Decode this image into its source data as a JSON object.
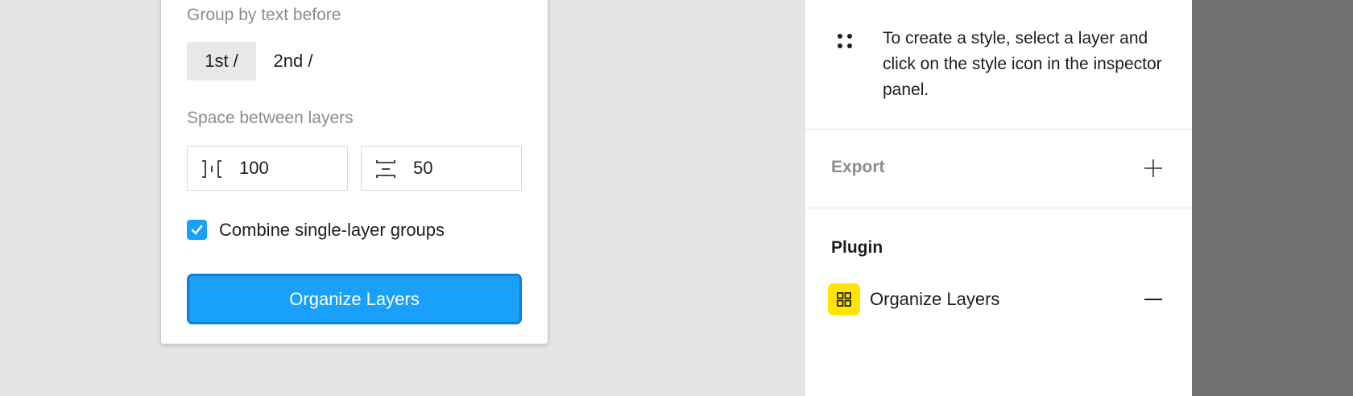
{
  "plugin_panel": {
    "group_label": "Group by text before",
    "segments": [
      "1st /",
      "2nd /"
    ],
    "space_label": "Space between layers",
    "horizontal_spacing": "100",
    "vertical_spacing": "50",
    "combine_label": "Combine single-layer groups",
    "combine_checked": true,
    "button_label": "Organize Layers"
  },
  "inspector": {
    "styles_hint": "To create a style, select a layer and click on the style icon in the inspector panel.",
    "export_title": "Export",
    "plugin_title": "Plugin",
    "plugin_name": "Organize Layers"
  },
  "colors": {
    "accent": "#18a0fb",
    "plugin_icon_bg": "#ffe500",
    "dark_strip": "#727272"
  },
  "icons": {
    "styles": "styles-icon",
    "horizontal_spacing": "horizontal-spacing-icon",
    "vertical_spacing": "vertical-spacing-icon",
    "checkbox": "check-icon",
    "export_add": "plus-icon",
    "plugin": "plugin-grid-icon",
    "remove": "minus-icon"
  }
}
